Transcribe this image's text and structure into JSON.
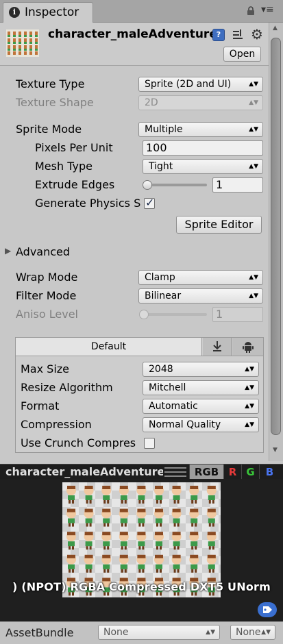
{
  "window": {
    "tab_label": "Inspector",
    "tab_icon": "info-icon"
  },
  "header": {
    "asset_name": "character_maleAdventurer",
    "open_label": "Open"
  },
  "texture": {
    "texture_type_label": "Texture Type",
    "texture_type_value": "Sprite (2D and UI)",
    "texture_shape_label": "Texture Shape",
    "texture_shape_value": "2D",
    "sprite_mode_label": "Sprite Mode",
    "sprite_mode_value": "Multiple",
    "ppu_label": "Pixels Per Unit",
    "ppu_value": "100",
    "mesh_type_label": "Mesh Type",
    "mesh_type_value": "Tight",
    "extrude_label": "Extrude Edges",
    "extrude_value": "1",
    "gen_physics_label": "Generate Physics S",
    "gen_physics_checked": true,
    "sprite_editor_label": "Sprite Editor",
    "advanced_label": "Advanced",
    "wrap_mode_label": "Wrap Mode",
    "wrap_mode_value": "Clamp",
    "filter_mode_label": "Filter Mode",
    "filter_mode_value": "Bilinear",
    "aniso_label": "Aniso Level",
    "aniso_value": "1"
  },
  "platform": {
    "tab_default": "Default",
    "max_size_label": "Max Size",
    "max_size_value": "2048",
    "resize_label": "Resize Algorithm",
    "resize_value": "Mitchell",
    "format_label": "Format",
    "format_value": "Automatic",
    "compression_label": "Compression",
    "compression_value": "Normal Quality",
    "crunch_label": "Use Crunch Compres",
    "crunch_checked": false
  },
  "preview": {
    "title": "character_maleAdventurer",
    "channel_rgb": "RGB",
    "channel_r": "R",
    "channel_g": "G",
    "channel_b": "B",
    "info": ") (NPOT)  RGBA Compressed DXT5 UNorm"
  },
  "asset_bundle": {
    "label": "AssetBundle",
    "name_value": "None",
    "variant_value": "None"
  },
  "colors": {
    "panel_bg": "#c8c8c8",
    "preview_bg": "#1f1f1f",
    "accent_blue": "#3a6fd0",
    "channel_red": "#e83a3a",
    "channel_green": "#39c439",
    "channel_blue": "#4a74f0"
  }
}
